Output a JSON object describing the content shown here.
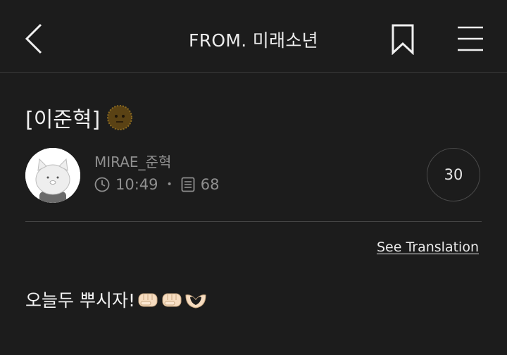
{
  "header": {
    "title": "FROM. 미래소년",
    "icons": {
      "back": "chevron-left-icon",
      "bookmark": "bookmark-icon",
      "menu": "hamburger-menu-icon"
    }
  },
  "post": {
    "title": "[이준혁]",
    "title_emoji": "round-face-emoji",
    "author": "MIRAE_준혁",
    "time": "10:49",
    "page_count": "68",
    "badge_count": "30",
    "translation_link": "See Translation",
    "body_text": "오늘두 뿌시자!",
    "body_emojis": [
      "fist-emoji",
      "fist-emoji",
      "heart-hands-emoji"
    ]
  },
  "colors": {
    "background": "#1c1c1c",
    "text": "#f2f2f2",
    "muted": "#8f8f8f",
    "divider": "#444444"
  }
}
